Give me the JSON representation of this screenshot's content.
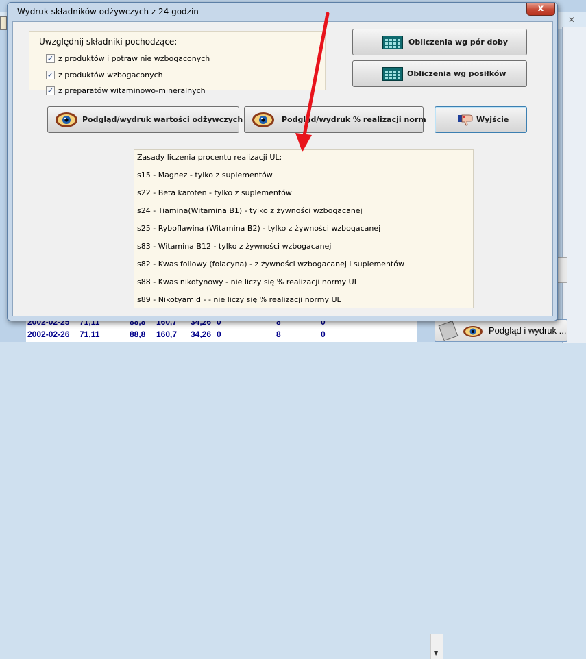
{
  "background": {
    "close_glyph": "✕",
    "rows": [
      {
        "date": "2002-02-25",
        "v1": "71,11",
        "v2": "88,8",
        "v3": "160,7",
        "v4": "34,26",
        "v5": "0",
        "v6": "8",
        "v7": "0"
      },
      {
        "date": "2002-02-26",
        "v1": "71,11",
        "v2": "88,8",
        "v3": "160,7",
        "v4": "34,26",
        "v5": "0",
        "v6": "8",
        "v7": "0"
      }
    ],
    "preview_button": "Podgląd i wydruk ..."
  },
  "dialog": {
    "title": "Wydruk składników odżywczych z 24 godzin",
    "close_glyph": "x",
    "group": {
      "title": "Uwzględnij składniki pochodzące:",
      "options": [
        {
          "label": "z produktów i potraw nie wzbogaconych",
          "checked": true
        },
        {
          "label": "z produktów wzbogaconych",
          "checked": true
        },
        {
          "label": "z preparatów witaminowo-mineralnych",
          "checked": true
        }
      ],
      "check_glyph": "✓"
    },
    "buttons": {
      "calc_by_daytime": "Obliczenia wg pór doby",
      "calc_by_meals": "Obliczenia wg posiłków",
      "preview_values": "Podgląd/wydruk wartości odżywczych",
      "preview_norms": "Podgląd/wydruk % realizacji norm",
      "exit": "Wyjście"
    },
    "info": {
      "heading": "Zasady liczenia procentu realizacji UL:",
      "lines": [
        "s15 - Magnez - tylko z suplementów",
        "s22 - Beta karoten  - tylko z suplementów",
        "s24 - Tiamina(Witamina B1) - tylko z żywności wzbogacanej",
        "s25 - Ryboflawina (Witamina B2) - tylko z żywności wzbogacanej",
        "s83 - Witamina B12 - tylko z żywności wzbogacanej",
        "s82 - Kwas foliowy (folacyna) - z żywności wzbogacanej i suplementów",
        "s88 - Kwas nikotynowy - nie liczy się % realizacji normy UL",
        "s89 - Nikotyamid -  - nie liczy się % realizacji normy UL"
      ]
    }
  },
  "colors": {
    "arrow": "#e8141c",
    "calc_icon": "#0f6a6e",
    "table_text": "#00008b"
  },
  "icons": {
    "calc": "calculator-icon",
    "eye": "eye-icon",
    "exit": "thumbs-down-hand-icon"
  }
}
